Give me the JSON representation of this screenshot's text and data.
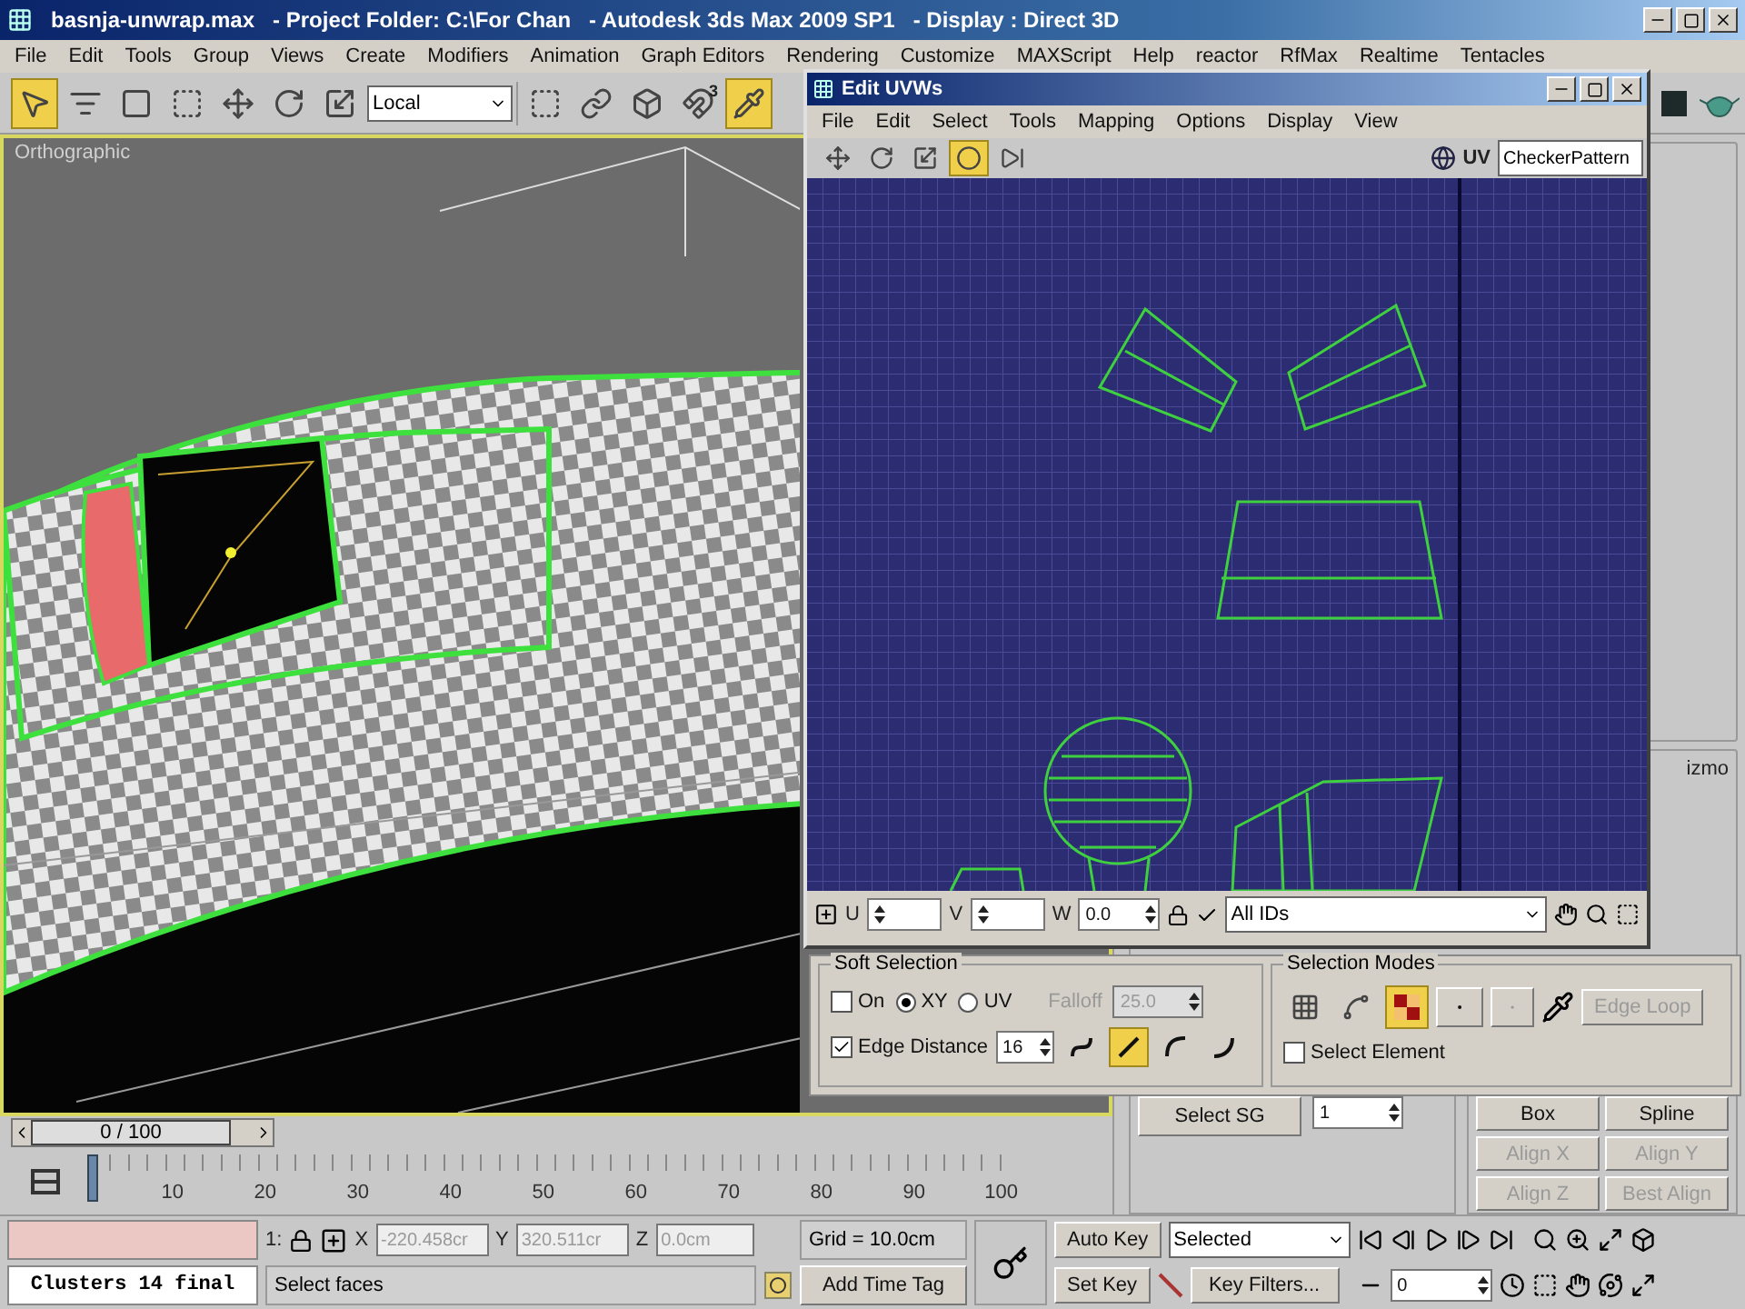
{
  "window": {
    "title_parts": [
      "basnja-unwrap.max",
      "- Project Folder: C:\\For Chan",
      "- Autodesk 3ds Max 2009 SP1",
      "- Display : Direct 3D"
    ]
  },
  "menu": [
    "File",
    "Edit",
    "Tools",
    "Group",
    "Views",
    "Create",
    "Modifiers",
    "Animation",
    "Graph Editors",
    "Rendering",
    "Customize",
    "MAXScript",
    "Help",
    "reactor",
    "RfMax",
    "Realtime",
    "Tentacles"
  ],
  "main_toolbar": {
    "tools": [
      {
        "selected": true
      },
      {
        "selected": false
      },
      {
        "selected": false
      },
      {
        "selected": false
      },
      {
        "selected": false
      },
      {
        "selected": false
      },
      {
        "selected": false
      }
    ],
    "coordinate_system": "Local",
    "angle_snap_label": "3",
    "snap_tools": [
      {
        "selected": false
      },
      {
        "selected": false
      },
      {
        "selected": false
      },
      {
        "selected": false
      },
      {
        "selected": true
      }
    ]
  },
  "viewport": {
    "label": "Orthographic"
  },
  "timeline": {
    "frame_counter": "0 / 100",
    "level": 0,
    "ruler_labels": [
      "10",
      "20",
      "30",
      "40",
      "50",
      "60",
      "70",
      "80",
      "90",
      "100"
    ]
  },
  "command_panel": {
    "partial_label": "izmo",
    "select_sg": "Select SG",
    "smoothing_group": "1",
    "map_buttons": [
      {
        "label": "Box",
        "disabled": false
      },
      {
        "label": "Spline",
        "disabled": false
      },
      {
        "label": "Align X",
        "disabled": true
      },
      {
        "label": "Align Y",
        "disabled": true
      },
      {
        "label": "Align Z",
        "disabled": true
      },
      {
        "label": "Best Align",
        "disabled": true
      }
    ]
  },
  "uvw_editor": {
    "title": "Edit UVWs",
    "menu": [
      "File",
      "Edit",
      "Select",
      "Tools",
      "Mapping",
      "Options",
      "Display",
      "View"
    ],
    "tools": [
      {
        "selected": false
      },
      {
        "selected": false
      },
      {
        "selected": false
      },
      {
        "selected": true
      },
      {
        "selected": false
      }
    ],
    "texture": "CheckerPattern",
    "uv_label": "UV",
    "bottom_bar": {
      "u_label": "U",
      "v_label": "V",
      "w_label": "W",
      "w_value": "0.0",
      "ids": "All IDs"
    },
    "soft_selection": {
      "title": "Soft Selection",
      "on": {
        "label": "On",
        "checked": false
      },
      "space": [
        {
          "label": "XY",
          "selected": true
        },
        {
          "label": "UV",
          "selected": false
        }
      ],
      "falloff": {
        "label": "Falloff",
        "value": "25.0",
        "disabled": true
      },
      "edge_distance": {
        "label": "Edge Distance",
        "checked": true,
        "value": "16"
      },
      "falloff_types": [
        {
          "selected": false
        },
        {
          "selected": true
        },
        {
          "selected": false
        },
        {
          "selected": false
        }
      ]
    },
    "selection_modes": {
      "title": "Selection Modes",
      "modes": [
        {
          "selected": false
        },
        {
          "selected": false
        },
        {
          "selected": true
        }
      ],
      "edge_loop": {
        "label": "Edge Loop",
        "disabled": true
      },
      "select_element": {
        "label": "Select Element",
        "checked": false
      }
    }
  },
  "status_bar": {
    "script_field": "Clusters 14 final",
    "selection_count": "1:",
    "x_label": "X",
    "x": "-220.458cr",
    "y_label": "Y",
    "y": "320.511cr",
    "z_label": "Z",
    "z": "0.0cm",
    "prompt": "Select faces",
    "grid": "Grid = 10.0cm",
    "time_tag": "Add Time Tag",
    "auto_key": "Auto Key",
    "set_key": "Set Key",
    "key_mode": "Selected",
    "key_filters": "Key Filters...",
    "frame": "0"
  }
}
